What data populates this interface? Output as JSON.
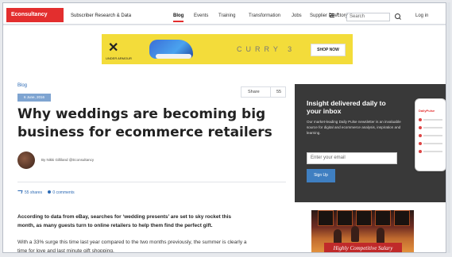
{
  "header": {
    "logo": "Econsultancy",
    "subscriber": "Subscriber Research & Data",
    "nav": [
      "Blog",
      "Events",
      "Training",
      "Transformation",
      "Jobs",
      "Supplier Directory"
    ],
    "search_placeholder": "Search",
    "login": "Log in"
  },
  "ad": {
    "brand": "UNDER ARMOUR",
    "headline": "CURRY 3",
    "cta": "SHOP NOW"
  },
  "article": {
    "category": "Blog",
    "date": "6 June, 2016",
    "title": "Why weddings are becoming big business for ecommerce retailers",
    "author": "By Nikki Gilliland @Econsultancy",
    "share_label": "Share",
    "share_count": "55",
    "shares": "55 shares",
    "comments": "0 comments",
    "lead": "According to data from eBay, searches for ‘wedding presents’ are set to sky rocket this month, as many guests turn to online retailers to help them find the perfect gift.",
    "paragraph": "With a 33% surge this time last year compared to the two months previously, the summer is clearly a time for love and last minute gift shopping."
  },
  "newsletter": {
    "title": "Insight delivered daily to your inbox",
    "text": "Our market-leading Daily Pulse newsletter is an invaluable source for digital and ecommerce analysis, inspiration and learning.",
    "email_placeholder": "Enter your email",
    "button": "Sign Up",
    "device_title": "DailyPulse"
  },
  "promo": {
    "label": "Highly Competitive Salary"
  }
}
